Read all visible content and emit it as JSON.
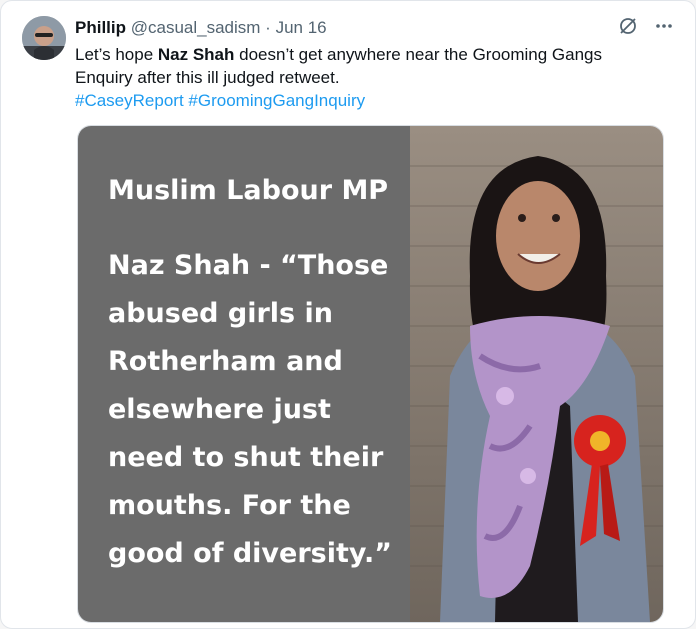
{
  "tweet": {
    "author_name": "Phillip",
    "handle": "@casual_sadism",
    "separator": "·",
    "date": "Jun 16",
    "text_part1": "Let’s hope ",
    "text_bold": "Naz Shah",
    "text_part2": " doesn’t get anywhere near the Grooming Gangs Enquiry after this ill judged retweet.",
    "hashtags": [
      "#CaseyReport",
      "#GroomingGangInquiry"
    ]
  },
  "icons": {
    "avatar": "avatar",
    "grok": "slashed-circle-icon",
    "more": "more-icon"
  },
  "media": {
    "title": "Muslim Labour MP",
    "quote": "Naz Shah - “Those abused girls in Rotherham and elsewhere just need to shut their mouths. For the good of diversity.”"
  },
  "colors": {
    "link": "#1d9bf0",
    "muted": "#536471",
    "media_panel": "#6b6b6b",
    "rosette": "#d7231e"
  }
}
